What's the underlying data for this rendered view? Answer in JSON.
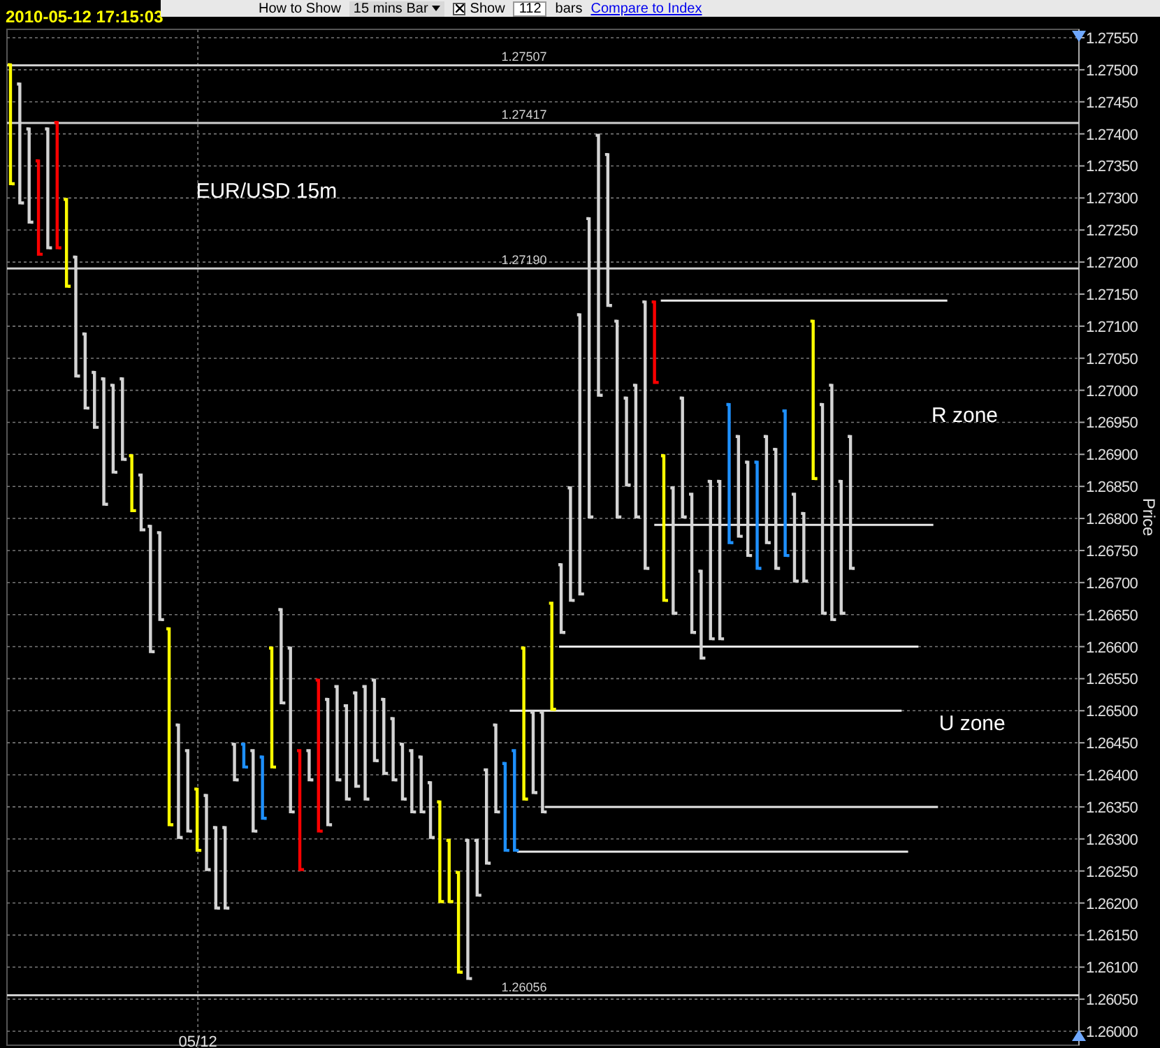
{
  "timestamp": "2010-05-12 17:15:03",
  "toolbar": {
    "show_mode_label": "How to Show",
    "bar_type": {
      "value": "15 mins Bar"
    },
    "show_checkbox": {
      "label": "Show",
      "checked": true
    },
    "bar_count": {
      "value": "112"
    },
    "bars_label": "bars",
    "compare_link": "Compare to Index"
  },
  "chart": {
    "title": "EUR/USD 15m",
    "axis_title": "Price",
    "price_labels": [
      "1.27550",
      "1.27500",
      "1.27450",
      "1.27400",
      "1.27350",
      "1.27300",
      "1.27250",
      "1.27200",
      "1.27150",
      "1.27100",
      "1.27050",
      "1.27000",
      "1.26950",
      "1.26900",
      "1.26850",
      "1.26800",
      "1.26750",
      "1.26700",
      "1.26650",
      "1.26600",
      "1.26550",
      "1.26500",
      "1.26450",
      "1.26400",
      "1.26350",
      "1.26300",
      "1.26250",
      "1.26200",
      "1.26150",
      "1.26100",
      "1.26050",
      "1.26000"
    ],
    "level_labels": [
      "1.27507",
      "1.27417",
      "1.27190",
      "1.26056"
    ],
    "date_label": "05/12",
    "zone_labels": [
      "R zone",
      "U zone"
    ]
  }
}
